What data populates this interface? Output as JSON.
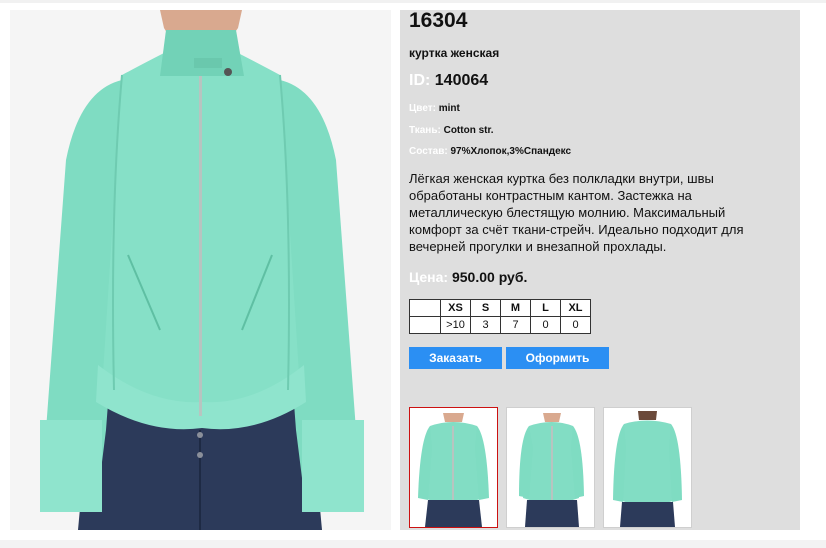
{
  "product": {
    "model": "16304",
    "subtitle": "куртка женская",
    "id_label": "ID:",
    "id_value": "140064",
    "color_label": "Цвет:",
    "color_value": "mint",
    "fabric_label": "Ткань:",
    "fabric_value": "Cotton str.",
    "composition_label": "Состав:",
    "composition_value": "97%Хлопок,3%Спандекс",
    "description": "Лёгкая женская куртка без полкладки внутри, швы обработаны контрастным кантом. Застежка на металлическую блестящую молнию. Максимальный комфорт за счёт ткани-стрейч. Идеально подходит для вечерней прогулки и внезапной прохлады.",
    "price_label": "Цена:",
    "price_value": "950.00 руб."
  },
  "sizes": {
    "headers": [
      "",
      "XS",
      "S",
      "M",
      "L",
      "XL"
    ],
    "values": [
      "",
      ">10",
      "3",
      "7",
      "0",
      "0"
    ]
  },
  "buttons": {
    "order": "Заказать",
    "checkout": "Оформить"
  },
  "colors": {
    "jacket": "#7fdcc2",
    "jeans": "#2c3a5a",
    "accent": "#2b8ff3",
    "selected_border": "#cc1111"
  }
}
